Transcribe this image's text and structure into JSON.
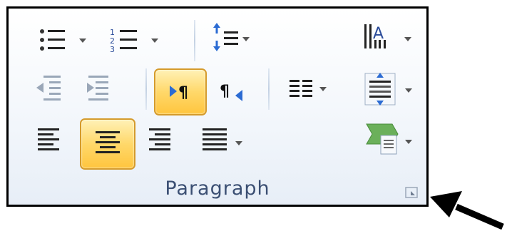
{
  "ribbon": {
    "group_label": "Paragraph",
    "accent_color": "#d59b2c",
    "highlight_color": "#ffd86a",
    "rows": [
      [
        "bullets-icon",
        "numbering-icon",
        "sort-icon",
        "line-spacing-icon"
      ],
      [
        "decrease-indent-icon",
        "increase-indent-icon",
        "ltr-icon",
        "rtl-icon",
        "columns-icon",
        "spacing-icon"
      ],
      [
        "align-left-icon",
        "align-center-icon",
        "align-right-icon",
        "justify-icon",
        "shading-icon"
      ]
    ],
    "pressed": [
      "ltr-icon",
      "align-center-icon"
    ]
  }
}
